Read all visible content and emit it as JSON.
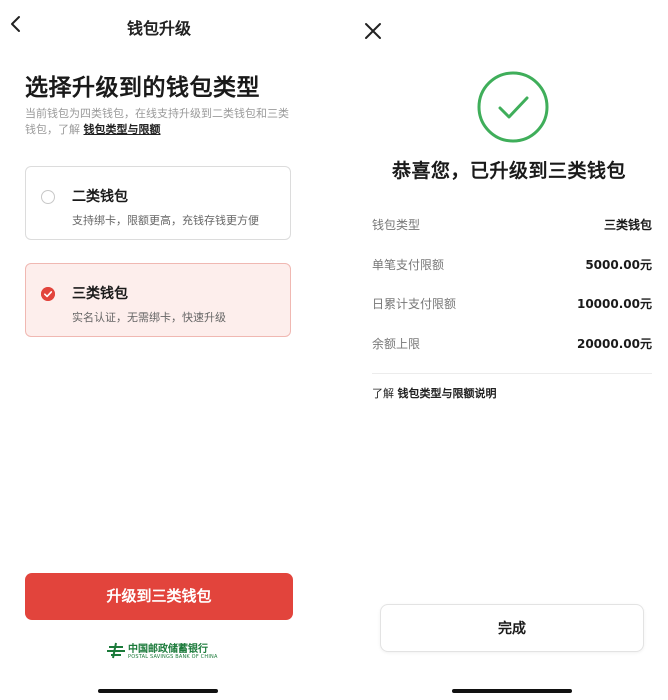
{
  "colors": {
    "accent": "#e2443c",
    "success": "#3fae5a",
    "logo_green": "#1b7a3a"
  },
  "upgrade_screen": {
    "back_icon": "chevron-left-icon",
    "nav_title": "钱包升级",
    "page_title": "选择升级到的钱包类型",
    "subtitle_text": "当前钱包为四类钱包，在线支持升级到二类钱包和三类钱包，了解 ",
    "subtitle_link": "钱包类型与限额",
    "options": [
      {
        "title": "二类钱包",
        "desc": "支持绑卡，限额更高，充钱存钱更方便",
        "selected": false
      },
      {
        "title": "三类钱包",
        "desc": "实名认证，无需绑卡，快速升级",
        "selected": true
      }
    ],
    "button_label": "升级到三类钱包",
    "bank_logo_cn": "中国邮政储蓄银行",
    "bank_logo_en": "POSTAL SAVINGS BANK OF CHINA"
  },
  "success_screen": {
    "close_icon": "close-icon",
    "status_icon": "check-circle-icon",
    "title": "恭喜您，已升级到三类钱包",
    "details": [
      {
        "label": "钱包类型",
        "value": "三类钱包"
      },
      {
        "label": "单笔支付限额",
        "value": "5000.00元"
      },
      {
        "label": "日累计支付限额",
        "value": "10000.00元"
      },
      {
        "label": "余额上限",
        "value": "20000.00元"
      }
    ],
    "learn_prefix": "了解 ",
    "learn_link": "钱包类型与限额说明",
    "done_label": "完成"
  }
}
